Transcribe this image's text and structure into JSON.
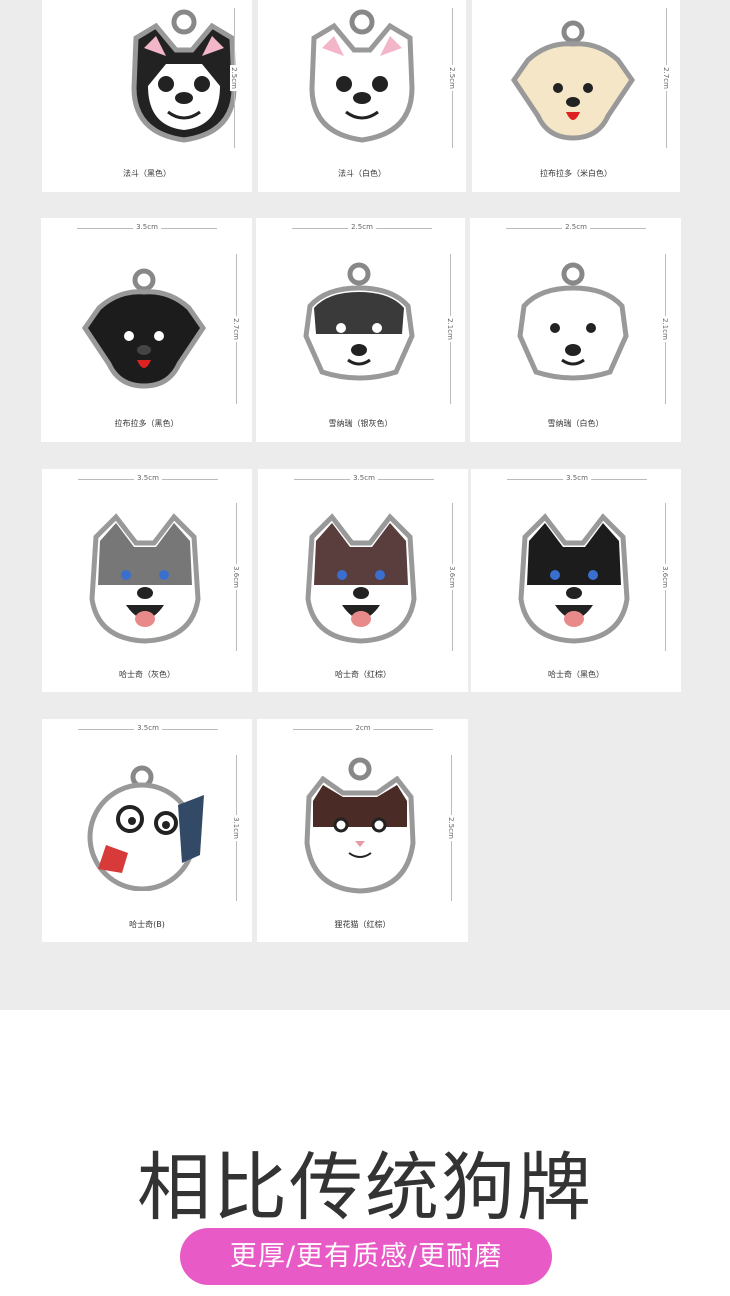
{
  "cards": [
    {
      "label": "法斗（黑色）",
      "dim_h": "",
      "dim_v": "2.5cm",
      "icon": "french-bulldog-black-tag"
    },
    {
      "label": "法斗（白色）",
      "dim_h": "",
      "dim_v": "2.5cm",
      "icon": "french-bulldog-white-tag"
    },
    {
      "label": "拉布拉多（米白色）",
      "dim_h": "",
      "dim_v": "2.7cm",
      "icon": "labrador-cream-tag"
    },
    {
      "label": "拉布拉多（黑色）",
      "dim_h": "3.5cm",
      "dim_v": "2.7cm",
      "icon": "labrador-black-tag"
    },
    {
      "label": "雪纳瑞（银灰色）",
      "dim_h": "2.5cm",
      "dim_v": "2.1cm",
      "icon": "schnauzer-silver-tag"
    },
    {
      "label": "雪纳瑞（白色）",
      "dim_h": "2.5cm",
      "dim_v": "2.1cm",
      "icon": "schnauzer-white-tag"
    },
    {
      "label": "哈士奇（灰色）",
      "dim_h": "3.5cm",
      "dim_v": "3.6cm",
      "icon": "husky-grey-tag"
    },
    {
      "label": "哈士奇（红棕）",
      "dim_h": "3.5cm",
      "dim_v": "3.6cm",
      "icon": "husky-brown-tag"
    },
    {
      "label": "哈士奇（黑色）",
      "dim_h": "3.5cm",
      "dim_v": "3.6cm",
      "icon": "husky-black-tag"
    },
    {
      "label": "哈士奇(B)",
      "dim_h": "3.5cm",
      "dim_v": "3.1cm",
      "icon": "husky-b-tag"
    },
    {
      "label": "狸花猫（红棕）",
      "dim_h": "2cm",
      "dim_v": "2.5cm",
      "icon": "tabby-cat-tag"
    }
  ],
  "headline": "相比传统狗牌",
  "pill": "更厚/更有质感/更耐磨",
  "colors": {
    "gallery_bg": "#ececec",
    "pill": "#e85ac6",
    "text": "#333333"
  }
}
